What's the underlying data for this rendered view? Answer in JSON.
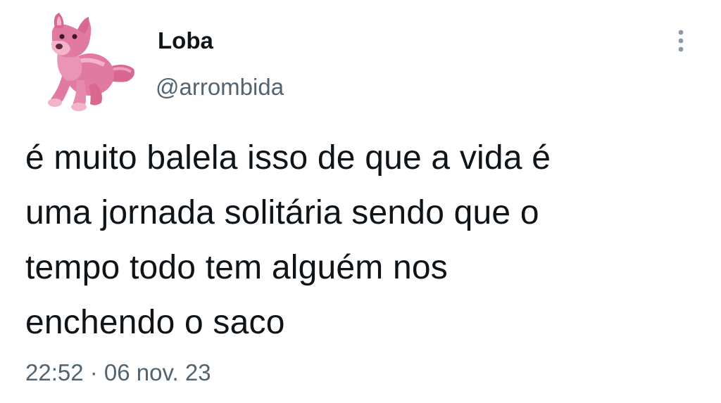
{
  "tweet": {
    "author": {
      "display_name": "Loba",
      "handle": "@arrombida",
      "avatar_icon": "pink-wolf-plush-avatar-icon"
    },
    "text_lines": [
      "é muito balela isso de que a vida é",
      "uma jornada solitária sendo que o",
      "tempo todo tem alguém nos",
      "enchendo o saco"
    ],
    "timestamp": "22:52 · 06 nov. 23",
    "more_icon": "vertical-ellipsis-icon"
  },
  "colors": {
    "text_primary": "#0f1419",
    "text_secondary": "#536471",
    "avatar_pink": "#e07aa0",
    "background": "#ffffff"
  }
}
